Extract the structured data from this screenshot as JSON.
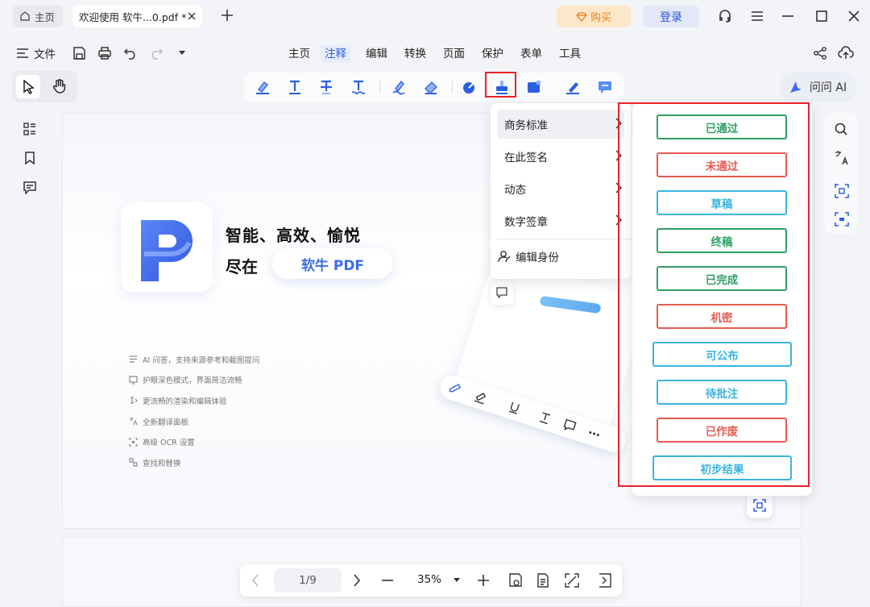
{
  "titlebar": {
    "home_tab": "主页",
    "doc_tab": "欢迎使用 软牛...0.pdf *",
    "buy": "购买",
    "login": "登录"
  },
  "menubar": {
    "file": "文件",
    "items": [
      "主页",
      "注释",
      "编辑",
      "转换",
      "页面",
      "保护",
      "表单",
      "工具"
    ],
    "active": "注释"
  },
  "ask_ai": "问问 AI",
  "hero": {
    "line1": "智能、高效、愉悦",
    "line2": "尽在",
    "pill": "软牛 PDF"
  },
  "features": [
    "AI 问答，支持来源参考和截图提问",
    "护眼深色模式，界面简洁流畅",
    "更流畅的渲染和编辑体验",
    "全新翻译面板",
    "高级 OCR 设置",
    "查找和替换"
  ],
  "stamp_menu": {
    "items": [
      "商务标准",
      "在此签名",
      "动态",
      "数字签章"
    ],
    "edit_identity": "编辑身份"
  },
  "stamps": [
    {
      "label": "已通过",
      "color": "#2e9e64"
    },
    {
      "label": "未通过",
      "color": "#e85a4f"
    },
    {
      "label": "草稿",
      "color": "#3ab4e0"
    },
    {
      "label": "终稿",
      "color": "#2e9e64"
    },
    {
      "label": "已完成",
      "color": "#2e9e64"
    },
    {
      "label": "机密",
      "color": "#e85a4f"
    },
    {
      "label": "可公布",
      "color": "#3ab4e0"
    },
    {
      "label": "待批注",
      "color": "#3ab4e0"
    },
    {
      "label": "已作废",
      "color": "#e85a4f"
    },
    {
      "label": "初步结果",
      "color": "#3ab4e0"
    }
  ],
  "navigation": {
    "page": "1/9",
    "zoom": "35%"
  },
  "colors": {
    "accent": "#2b5fe0",
    "highlight_red": "#e8232b"
  }
}
